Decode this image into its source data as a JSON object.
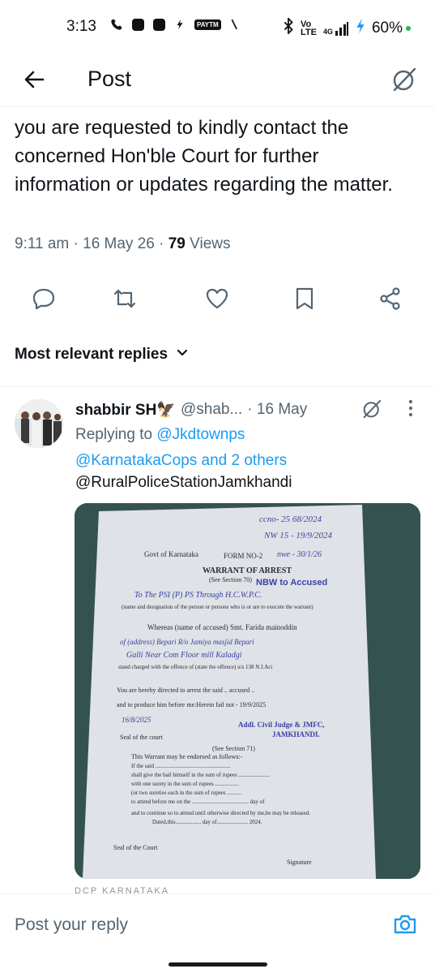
{
  "status_bar": {
    "time": "3:13",
    "signal_label": "4G",
    "volte_label": "Vo LTE",
    "battery": "60%",
    "left_icons": [
      "phone-icon",
      "app-icon",
      "app-icon",
      "app-icon",
      "paytm-icon",
      "pen-icon"
    ],
    "right_icons": [
      "bluetooth-icon",
      "signal-icon",
      "battery-charging-icon"
    ]
  },
  "header": {
    "title": "Post"
  },
  "post": {
    "text": "you are requested to kindly contact the concerned Hon'ble Court for further information or updates regarding the matter.",
    "timestamp": "9:11 am · 16 May 26 · ",
    "views_count": "79",
    "views_label": " Views"
  },
  "actions": [
    "reply-icon",
    "repost-icon",
    "like-icon",
    "bookmark-icon",
    "share-icon"
  ],
  "replies_sort": {
    "label": "Most relevant replies"
  },
  "reply": {
    "name": "shabbir SH🦅",
    "handle": "@shab...",
    "date": "· 16 May",
    "replying_prefix": "Replying to ",
    "mention_1": "@Jkdtownps",
    "mention_2": "@KarnatakaCops",
    "replying_suffix": " and 2 others",
    "body": "@RuralPoliceStationJamkhandi",
    "media": {
      "top_handwriting_1": "ccno- 25 68/2024",
      "top_handwriting_2": "NW 15 - 19/9/2024",
      "top_handwriting_3": "nwe - 30/1/26",
      "govt": "Govt of Karnataka",
      "form": "FORM NO-2",
      "title": "WARRANT OF ARREST",
      "section": "(See Section 70)",
      "stamp": "NBW to Accused",
      "line_to": "To The PSI (P) PS Through H.C.W.P.C.",
      "line_desig": "(name and designation of the person or persons who is or are to execute the warrant)",
      "line_accused": "Whereas (name of accused) Smt. Farida mainoddin",
      "line_address": "of (address) Bepari R/o Jamiya masjid Bepari",
      "line_address2": "Galli Near Com Floor mill Kaladgi",
      "line_charged": "stand charged with the offence of (state the offence) u/s 138 N.I.Act",
      "line_directed": "You are hereby directed to arrest the said .. accused ..",
      "line_produce": "and to produce him before me:Herein fail not - 19/9/2025",
      "line_date": "16/8/2025",
      "seal": "Seal of the court",
      "judge": "Addl. Civil Judge & JMFC,",
      "judge_place": "JAMKHANDI.",
      "section71": "(See Section 71)",
      "endorse_1": "This Warrant may be endorsed as follows:-",
      "endorse_2": "If the said .....................................................",
      "endorse_3": "shall give the bail himself in the sum of rupees ......................",
      "endorse_4": "with one surety in the sum of rupees .................",
      "endorse_5": "(or two sureties each in the sum of rupees ..........",
      "endorse_6": "to attend before me on the ........................................ day of",
      "endorse_7": "and to continue so to attend until otherwise directed by me,he may be released.",
      "endorse_8": "Dated,this.................. day of...................... 2024.",
      "seal2": "Seal of the Court",
      "signature": "Signature",
      "peek": "DCP KARNATAKA"
    }
  },
  "compose": {
    "placeholder": "Post your reply"
  },
  "colors": {
    "accent": "#1d9bf0",
    "text_primary": "#0f1419",
    "text_secondary": "#536471",
    "divider": "#eff3f4"
  }
}
